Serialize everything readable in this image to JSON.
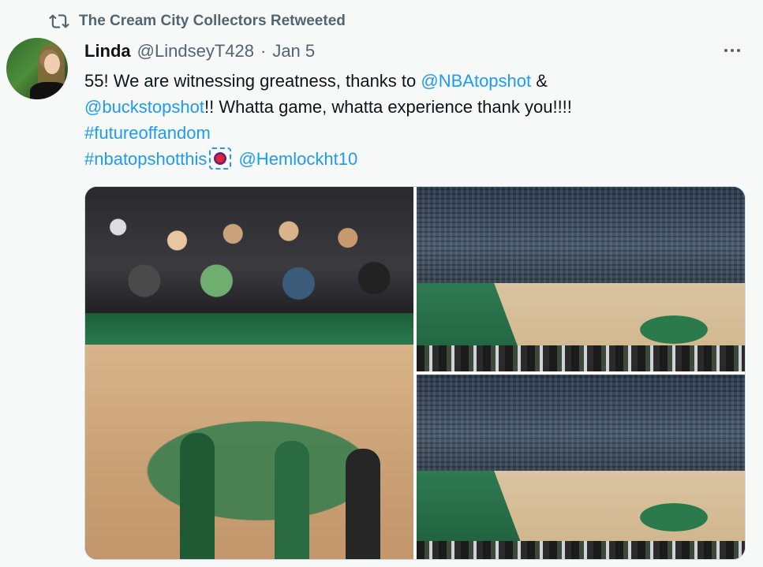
{
  "retweet": {
    "icon": "retweet-icon",
    "text": "The Cream City Collectors Retweeted"
  },
  "tweet": {
    "author": {
      "name": "Linda",
      "handle": "@LindseyT428",
      "separator": "·",
      "date": "Jan 5"
    },
    "text": {
      "l1_pre": "55! We are witnessing greatness, thanks to ",
      "l1_mention": "@NBAtopshot",
      "l1_post": " &",
      "l2_mention": "@buckstopshot",
      "l2_post": "!! Whatta game, whatta experience thank you!!!!",
      "hashtag1": "#futureoffandom",
      "hashtag2": "#nbatopshotthis",
      "emoji": "basketball-hashflag",
      "l4_mention": "@Hemlockht10"
    },
    "media": {
      "photo_count": 3
    }
  },
  "colors": {
    "link": "#1d9bf0",
    "secondary_text": "#536471",
    "primary_text": "#0f1419",
    "background": "#f7f9f9"
  }
}
